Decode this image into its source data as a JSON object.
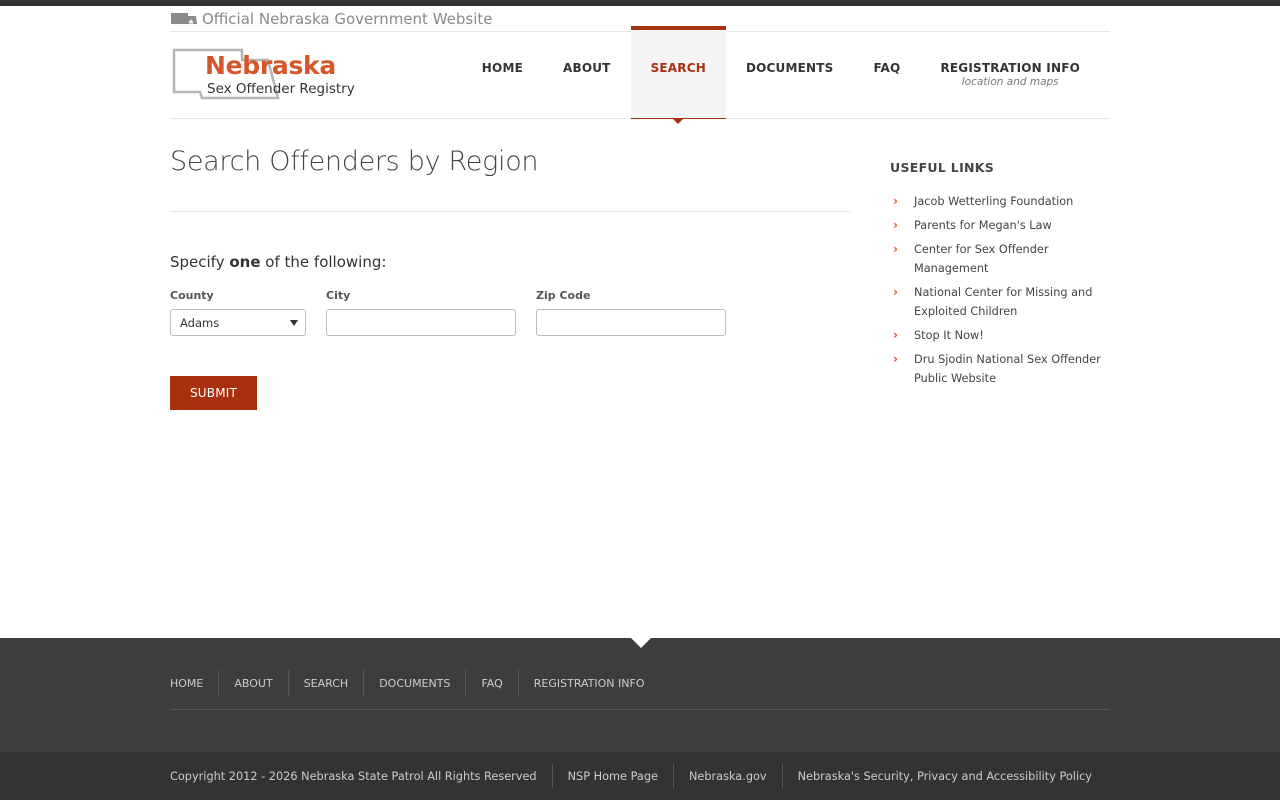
{
  "official": {
    "text": "Official Nebraska Government Website",
    "icon": "nebraska-state-icon"
  },
  "logo": {
    "line1": "Nebraska",
    "line2": "Sex Offender Registry"
  },
  "nav": {
    "items": [
      {
        "label": "HOME"
      },
      {
        "label": "ABOUT"
      },
      {
        "label": "SEARCH",
        "active": true
      },
      {
        "label": "DOCUMENTS"
      },
      {
        "label": "FAQ"
      },
      {
        "label": "REGISTRATION INFO",
        "sub": "location and maps"
      }
    ]
  },
  "main": {
    "title": "Search Offenders by Region",
    "specify_prefix": "Specify ",
    "specify_bold": "one",
    "specify_suffix": " of the following:",
    "county_label": "County",
    "county_value": "Adams",
    "city_label": "City",
    "city_value": "",
    "zip_label": "Zip Code",
    "zip_value": "",
    "submit_label": "SUBMIT"
  },
  "sidebar": {
    "title": "USEFUL LINKS",
    "links": [
      "Jacob Wetterling Foundation",
      "Parents for Megan's Law",
      "Center for Sex Offender Management",
      "National Center for Missing and Exploited Children",
      "Stop It Now!",
      "Dru Sjodin National Sex Offender Public Website"
    ]
  },
  "footer": {
    "nav": [
      "HOME",
      "ABOUT",
      "SEARCH",
      "DOCUMENTS",
      "FAQ",
      "REGISTRATION INFO"
    ],
    "copyright": "Copyright 2012 - 2026 Nebraska State Patrol All Rights Reserved",
    "links": [
      "NSP Home Page",
      "Nebraska.gov",
      "Nebraska's Security, Privacy and Accessibility Policy"
    ]
  },
  "colors": {
    "accent": "#a7300f",
    "logo_orange": "#d4562a",
    "footer_bg": "#3d3d3d"
  }
}
